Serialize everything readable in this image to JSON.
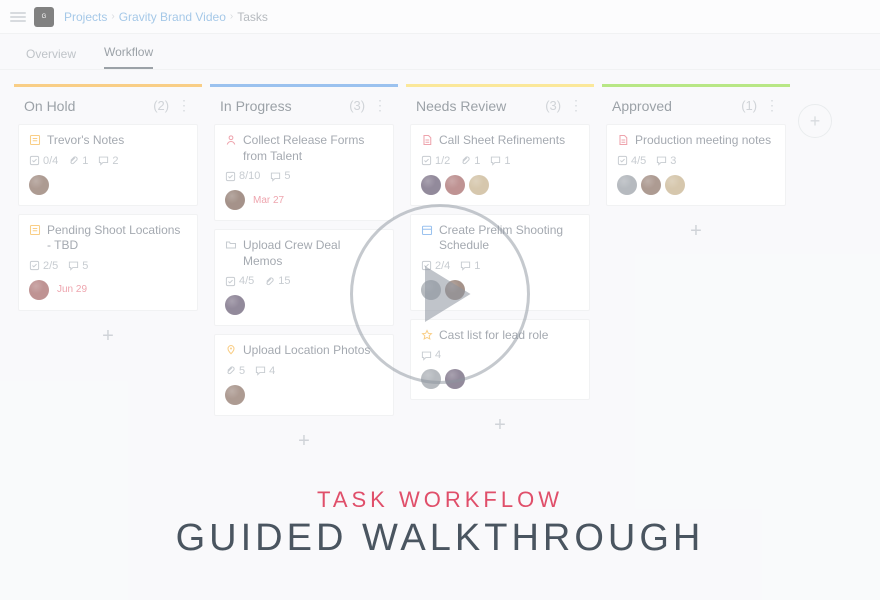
{
  "breadcrumb": {
    "projects": "Projects",
    "project": "Gravity Brand Video",
    "current": "Tasks"
  },
  "tabs": {
    "overview": "Overview",
    "workflow": "Workflow"
  },
  "columns": [
    {
      "title": "On Hold",
      "count": "2",
      "cards": [
        {
          "icon": "note",
          "icon_color": "#f5a623",
          "title": "Trevor's Notes",
          "checks": "0/4",
          "attach": "1",
          "comments": "2",
          "avatars": [
            "#6b4a3a"
          ],
          "due": ""
        },
        {
          "icon": "note",
          "icon_color": "#f5a623",
          "title": "Pending Shoot Locations - TBD",
          "checks": "2/5",
          "attach": "",
          "comments": "5",
          "avatars": [
            "#8a3b3b"
          ],
          "due": "Jun 29"
        }
      ]
    },
    {
      "title": "In Progress",
      "count": "3",
      "cards": [
        {
          "icon": "person",
          "icon_color": "#e05a6b",
          "title": "Collect Release Forms from Talent",
          "checks": "8/10",
          "attach": "",
          "comments": "5",
          "avatars": [
            "#5b3a2a"
          ],
          "due": "Mar 27"
        },
        {
          "icon": "folder",
          "icon_color": "#9aa2ab",
          "title": "Upload Crew Deal Memos",
          "checks": "4/5",
          "attach": "15",
          "comments": "",
          "avatars": [
            "#3a2a4a"
          ],
          "due": ""
        },
        {
          "icon": "pin",
          "icon_color": "#f5a623",
          "title": "Upload Location Photos",
          "checks": "",
          "attach": "5",
          "comments": "4",
          "avatars": [
            "#6b4a3a"
          ],
          "due": ""
        }
      ]
    },
    {
      "title": "Needs Review",
      "count": "3",
      "cards": [
        {
          "icon": "doc",
          "icon_color": "#e05a6b",
          "title": "Call Sheet Refinements",
          "checks": "1/2",
          "attach": "1",
          "comments": "1",
          "avatars": [
            "#3a2a4a",
            "#8a3b3b",
            "#b59a6a"
          ],
          "due": ""
        },
        {
          "icon": "cal",
          "icon_color": "#4a90e2",
          "title": "Create Prelim Shooting Schedule",
          "checks": "2/4",
          "attach": "",
          "comments": "1",
          "avatars": [
            "#7a828b",
            "#5b3a2a"
          ],
          "due": ""
        },
        {
          "icon": "star",
          "icon_color": "#f5a623",
          "title": "Cast list for lead role",
          "checks": "",
          "attach": "",
          "comments": "4",
          "avatars": [
            "#7a828b",
            "#3a2a4a"
          ],
          "due": ""
        }
      ]
    },
    {
      "title": "Approved",
      "count": "1",
      "cards": [
        {
          "icon": "doc",
          "icon_color": "#e05a6b",
          "title": "Production meeting notes",
          "checks": "4/5",
          "attach": "",
          "comments": "3",
          "avatars": [
            "#7a828b",
            "#6b4a3a",
            "#b59a6a"
          ],
          "due": ""
        }
      ]
    }
  ],
  "overlay": {
    "subtitle": "TASK WORKFLOW",
    "title": "GUIDED WALKTHROUGH"
  }
}
